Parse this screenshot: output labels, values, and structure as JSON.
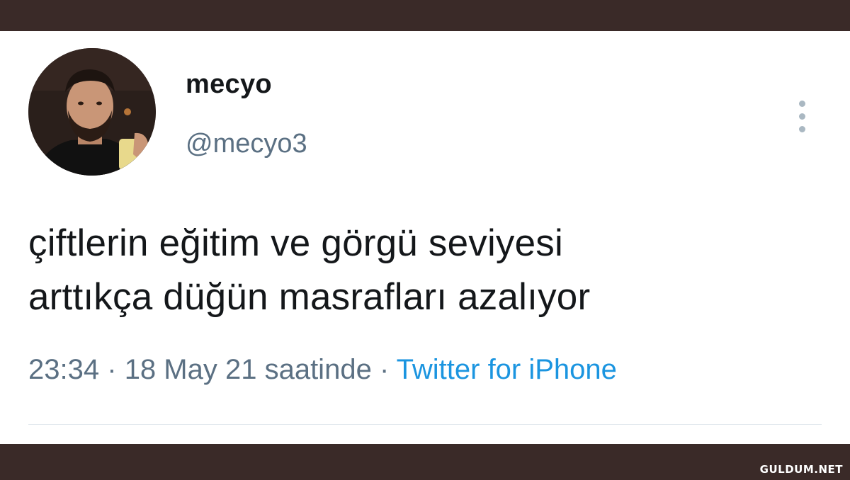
{
  "tweet": {
    "display_name": "mecyo",
    "handle": "@mecyo3",
    "text_line_1": "çiftlerin eğitim ve görgü seviyesi",
    "text_line_2": "arttıkça düğün masrafları azalıyor",
    "time": "23:34",
    "date": "18 May 21 saatinde",
    "separator": "·",
    "source": "Twitter for iPhone",
    "avatar_icon": "profile-photo",
    "more_icon": "vertical-ellipsis-icon"
  },
  "watermark": "GULDUM.NET",
  "colors": {
    "frame": "#3a2a28",
    "card": "#ffffff",
    "text": "#14171a",
    "muted": "#5b7083",
    "link": "#1b95e0"
  }
}
